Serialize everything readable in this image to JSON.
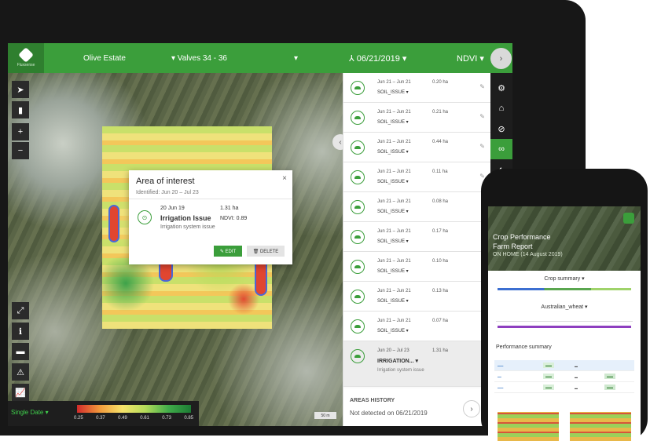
{
  "app": {
    "logo_text": "Fluxsense",
    "estate": "Olive Estate",
    "valves": "▾ Valves 34 - 36",
    "caret": "▾",
    "date": "⅄ 06/21/2019 ▾",
    "index": "NDVI ▾",
    "next_btn": "›"
  },
  "map_tools": {
    "top": [
      "➤",
      "▮",
      "+",
      "−"
    ],
    "bottom": [
      "⤢",
      "ℹ",
      "▬",
      "⚠",
      "📈",
      "◈",
      "↺"
    ]
  },
  "popup": {
    "title": "Area of interest",
    "close": "×",
    "identified": "Identified: Jun 20 – Jul 23",
    "date": "20 Jun 19",
    "area": "1.31 ha",
    "type": "Irrigation Issue",
    "ndvi": "NDVI: 0.89",
    "desc": "Irrigation system issue",
    "edit": "✎ EDIT",
    "delete": "🗑 DELETE"
  },
  "legend": {
    "label": "Single Date ▾",
    "ticks": [
      "0.25",
      "0.37",
      "0.49",
      "0.61",
      "0.73",
      "0.85"
    ],
    "scale": "50 m"
  },
  "collapse": "‹",
  "issues": [
    {
      "dates": "Jun 21 – Jun 21",
      "area": "0.20 ha",
      "type": "SOIL_ISSUE ▾"
    },
    {
      "dates": "Jun 21 – Jun 21",
      "area": "0.21 ha",
      "type": "SOIL_ISSUE ▾"
    },
    {
      "dates": "Jun 21 – Jun 21",
      "area": "0.44 ha",
      "type": "SOIL_ISSUE ▾"
    },
    {
      "dates": "Jun 21 – Jun 21",
      "area": "0.11 ha",
      "type": "SOIL_ISSUE ▾"
    },
    {
      "dates": "Jun 21 – Jun 21",
      "area": "0.08 ha",
      "type": "SOIL_ISSUE ▾"
    },
    {
      "dates": "Jun 21 – Jun 21",
      "area": "0.17 ha",
      "type": "SOIL_ISSUE ▾"
    },
    {
      "dates": "Jun 21 – Jun 21",
      "area": "0.10 ha",
      "type": "SOIL_ISSUE ▾"
    },
    {
      "dates": "Jun 21 – Jun 21",
      "area": "0.13 ha",
      "type": "SOIL_ISSUE ▾"
    },
    {
      "dates": "Jun 21 – Jun 21",
      "area": "0.07 ha",
      "type": "SOIL_ISSUE ▾"
    }
  ],
  "selected_issue": {
    "dates": "Jun 20 – Jul 23",
    "area": "1.31 ha",
    "type": "IRRIGATION... ▾",
    "desc": "Irrigation system issue"
  },
  "history": {
    "title": "AREAS HISTORY",
    "status": "Not detected on 06/21/2019",
    "go": "›"
  },
  "rail": [
    "⚙",
    "⌂",
    "⊘",
    "∞",
    "◐"
  ],
  "phone": {
    "title1": "Crop Performance",
    "title2": "Farm Report",
    "subtitle": "ON HOME (14 August 2019)",
    "crop_summary": "Crop summary ▾",
    "crop_name": "Australian_wheat ▾",
    "performance": "Performance summary",
    "colors": {
      "accent": "#3b9e3b",
      "irrigation": "#8e3fbf"
    }
  }
}
